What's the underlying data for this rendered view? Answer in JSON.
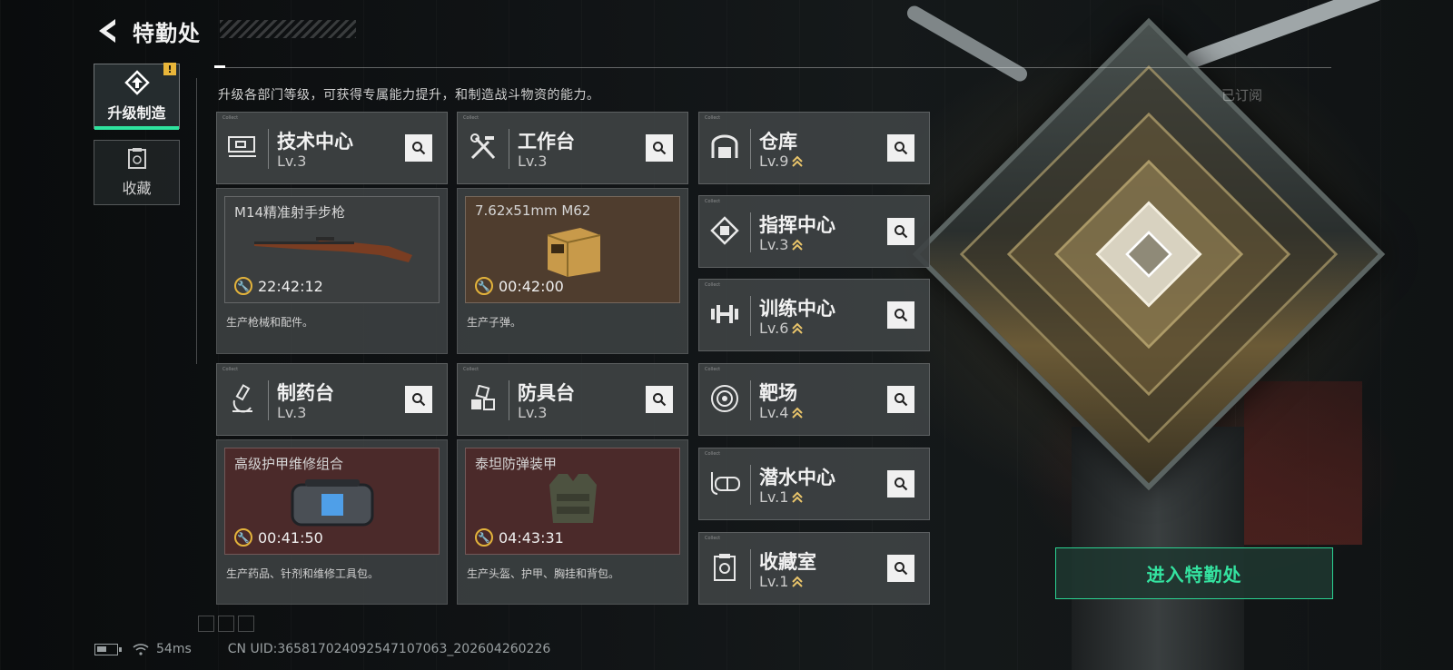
{
  "header": {
    "title": "特勤处"
  },
  "sidebar": {
    "tabs": [
      {
        "label": "升级制造",
        "icon": "upgrade-icon",
        "active": true,
        "badge": "!"
      },
      {
        "label": "收藏",
        "icon": "collection-icon",
        "active": false
      }
    ]
  },
  "subtitle": "升级各部门等级，可获得专属能力提升，和制造战斗物资的能力。",
  "subscribe_label": "已订阅",
  "facilities": {
    "tech": {
      "name": "技术中心",
      "level": "Lv.3",
      "icon": "circuit-board-icon"
    },
    "workbench": {
      "name": "工作台",
      "level": "Lv.3",
      "icon": "tools-icon"
    },
    "pharmacy": {
      "name": "制药台",
      "level": "Lv.3",
      "icon": "microscope-icon"
    },
    "armor": {
      "name": "防具台",
      "level": "Lv.3",
      "icon": "cubes-icon"
    },
    "warehouse": {
      "name": "仓库",
      "level": "Lv.9",
      "icon": "warehouse-icon",
      "upgradable": true
    },
    "command": {
      "name": "指挥中心",
      "level": "Lv.3",
      "icon": "chip-icon",
      "upgradable": true
    },
    "training": {
      "name": "训练中心",
      "level": "Lv.6",
      "icon": "dumbbell-icon",
      "upgradable": true
    },
    "range": {
      "name": "靶场",
      "level": "Lv.4",
      "icon": "target-icon",
      "upgradable": true
    },
    "diving": {
      "name": "潜水中心",
      "level": "Lv.1",
      "icon": "diving-mask-icon",
      "upgradable": true
    },
    "collection": {
      "name": "收藏室",
      "level": "Lv.1",
      "icon": "collection-room-icon",
      "upgradable": true
    }
  },
  "productions": {
    "tech": {
      "item": "M14精准射手步枪",
      "timer": "22:42:12",
      "desc": "生产枪械和配件。",
      "bg": "gray"
    },
    "workbench": {
      "item": "7.62x51mm M62",
      "timer": "00:42:00",
      "desc": "生产子弹。",
      "bg": "brown"
    },
    "pharmacy": {
      "item": "高级护甲维修组合",
      "timer": "00:41:50",
      "desc": "生产药品、针剂和维修工具包。",
      "bg": "red"
    },
    "armor": {
      "item": "泰坦防弹装甲",
      "timer": "04:43:31",
      "desc": "生产头盔、护甲、胸挂和背包。",
      "bg": "red"
    }
  },
  "enter_button": "进入特勤处",
  "status": {
    "ping": "54ms",
    "uid": "CN UID:365817024092547107063_202604260226"
  },
  "colors": {
    "accent": "#2ee39e",
    "timer": "#e3b33b",
    "upgrade": "#e9c46a"
  }
}
